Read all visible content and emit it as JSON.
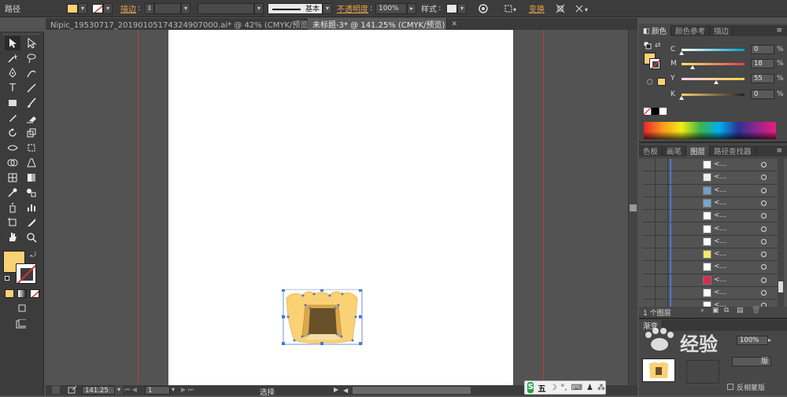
{
  "control_bar": {
    "path_label": "路径",
    "fill_color": "#fbd175",
    "stroke_label": "描边",
    "stroke_style_label": "基本",
    "opacity_label": "不透明度",
    "opacity_value": "100%",
    "style_label": "样式",
    "transform_label": "变换"
  },
  "tabs": [
    {
      "label": "Nipic_19530717_20190105174324907000.ai* @ 42% (CMYK/预览)",
      "close": "✕"
    },
    {
      "label": "未标题-3* @ 141.25% (CMYK/预览)",
      "close": "✕"
    }
  ],
  "status_bar": {
    "zoom": "141.25",
    "page": "1",
    "tool_name": "选择"
  },
  "color_panel": {
    "tabs": [
      "颜色",
      "颜色参考",
      "描边"
    ],
    "channels": [
      {
        "label": "C",
        "value": "0",
        "pct": "%",
        "level": 0,
        "gradient": [
          "#ffffff",
          "#00a0c8"
        ]
      },
      {
        "label": "M",
        "value": "18",
        "pct": "%",
        "level": 18,
        "gradient": [
          "#f7e56b",
          "#e04050"
        ]
      },
      {
        "label": "Y",
        "value": "55",
        "pct": "%",
        "level": 55,
        "gradient": [
          "#fbd1f5",
          "#f5d040"
        ]
      },
      {
        "label": "K",
        "value": "0",
        "pct": "%",
        "level": 0,
        "gradient": [
          "#fbd175",
          "#222222"
        ]
      }
    ]
  },
  "layers_panel": {
    "tabs": [
      "色板",
      "画笔",
      "图层",
      "路径查找器"
    ],
    "rows": [
      {
        "thumb": "#ffffff"
      },
      {
        "thumb": "#eeeeee"
      },
      {
        "thumb": "#6ea0c8"
      },
      {
        "thumb": "#7aa6c8"
      },
      {
        "thumb": "#ffffff"
      },
      {
        "thumb": "#ffffff"
      },
      {
        "thumb": "#ffffff"
      },
      {
        "thumb": "#f5e96b"
      },
      {
        "thumb": "#ffffff"
      },
      {
        "thumb": "#e0284a"
      },
      {
        "thumb": "#ffffff"
      },
      {
        "thumb": "#ffffff"
      }
    ],
    "row_label": "<...",
    "layer_count": "1 个图层"
  },
  "gradient_panel": {
    "tab_label": "渐变",
    "opacity_value": "100%",
    "mode_label": "版",
    "invert_label": "反相蒙版"
  },
  "watermark": {
    "text": "经验"
  },
  "taskbar": {
    "ime_label": "五"
  }
}
